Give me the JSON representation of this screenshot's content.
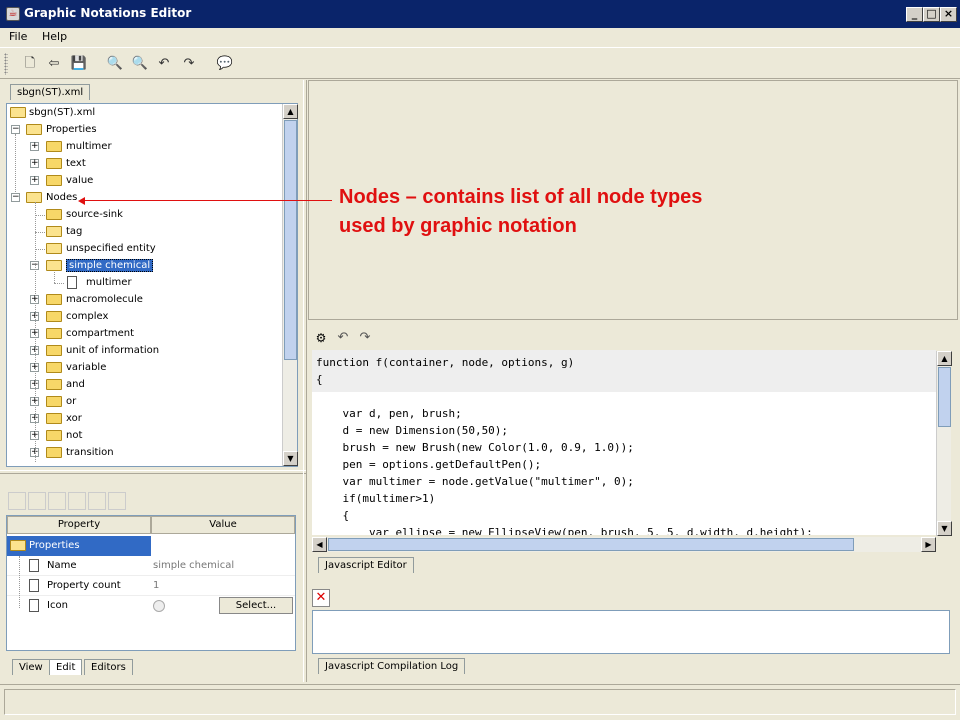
{
  "window": {
    "title": "Graphic Notations Editor"
  },
  "menu": {
    "items": [
      "File",
      "Help"
    ]
  },
  "toolbar": {
    "icons": [
      "new-file-icon",
      "open-icon",
      "save-icon",
      "zoom-in-icon",
      "zoom-out-icon",
      "undo-icon",
      "redo-icon",
      "info-icon"
    ]
  },
  "left": {
    "file_tab": "sbgn(ST).xml",
    "tree": {
      "root": "sbgn(ST).xml",
      "properties": "Properties",
      "prop_children": [
        "multimer",
        "text",
        "value"
      ],
      "nodes": "Nodes",
      "node_children_leaf": [
        "source-sink",
        "tag",
        "unspecified entity"
      ],
      "selected": "simple chemical",
      "selected_child": "multimer",
      "node_children_rest": [
        "macromolecule",
        "complex",
        "compartment",
        "unit of information",
        "variable",
        "and",
        "or",
        "xor",
        "not",
        "transition"
      ]
    },
    "properties_table": {
      "col_property": "Property",
      "col_value": "Value",
      "group": "Properties",
      "rows": [
        {
          "name": "Name",
          "value": "simple chemical"
        },
        {
          "name": "Property count",
          "value": "1"
        },
        {
          "name": "Icon",
          "value": ""
        }
      ],
      "select_button": "Select..."
    },
    "bottom_tabs": [
      "View",
      "Edit",
      "Editors"
    ]
  },
  "annotation": {
    "line1": "Nodes – contains list of all node types",
    "line2": "used by graphic notation"
  },
  "editor": {
    "code": [
      "function f(container, node, options, g)",
      "{",
      "",
      "    var d, pen, brush;",
      "    d = new Dimension(50,50);",
      "    brush = new Brush(new Color(1.0, 0.9, 1.0));",
      "    pen = options.getDefaultPen();",
      "    var multimer = node.getValue(\"multimer\", 0);",
      "    if(multimer>1)",
      "    {",
      "        var ellipse = new EllipseView(pen, brush, 5, 5, d.width, d.height);"
    ],
    "tab": "Javascript Editor",
    "log_tab": "Javascript Compilation Log"
  },
  "colors": {
    "accent": "#316AC5",
    "annotation": "#E01010",
    "titlebar": "#0A246A"
  }
}
